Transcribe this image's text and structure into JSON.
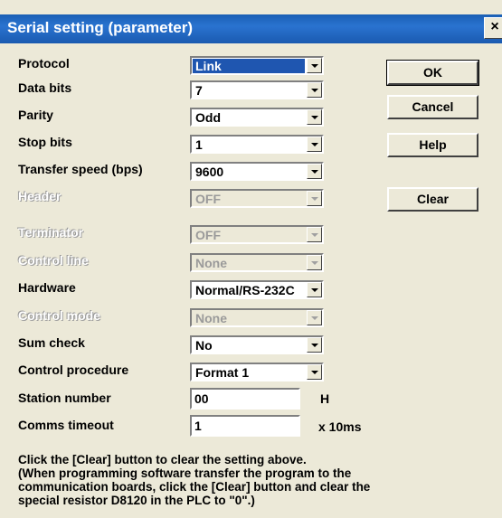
{
  "window": {
    "title": "Serial setting (parameter)",
    "close": "×"
  },
  "fields": [
    {
      "label": "Protocol",
      "value": "Link"
    },
    {
      "label": "Data bits",
      "value": "7"
    },
    {
      "label": "Parity",
      "value": "Odd"
    },
    {
      "label": "Stop bits",
      "value": "1"
    },
    {
      "label": "Transfer speed (bps)",
      "value": "9600"
    },
    {
      "label": "Header",
      "value": "OFF"
    },
    {
      "label": "Terminator",
      "value": "OFF"
    },
    {
      "label": "Control line",
      "value": "None"
    },
    {
      "label": "Hardware",
      "value": "Normal/RS-232C"
    },
    {
      "label": "Control mode",
      "value": "None"
    },
    {
      "label": "Sum check",
      "value": "No"
    },
    {
      "label": "Control procedure",
      "value": "Format 1"
    },
    {
      "label": "Station number",
      "value": "00",
      "unit": "H"
    },
    {
      "label": "Comms timeout",
      "value": "1",
      "unit": "x 10ms"
    }
  ],
  "buttons": {
    "ok": "OK",
    "cancel": "Cancel",
    "help": "Help",
    "clear": "Clear"
  },
  "note": [
    "Click the [Clear] button to clear the setting above.",
    "(When programming software transfer the program to the",
    "communication boards, click the [Clear] button and clear the",
    "special resistor D8120 in the PLC to \"0\".)"
  ]
}
